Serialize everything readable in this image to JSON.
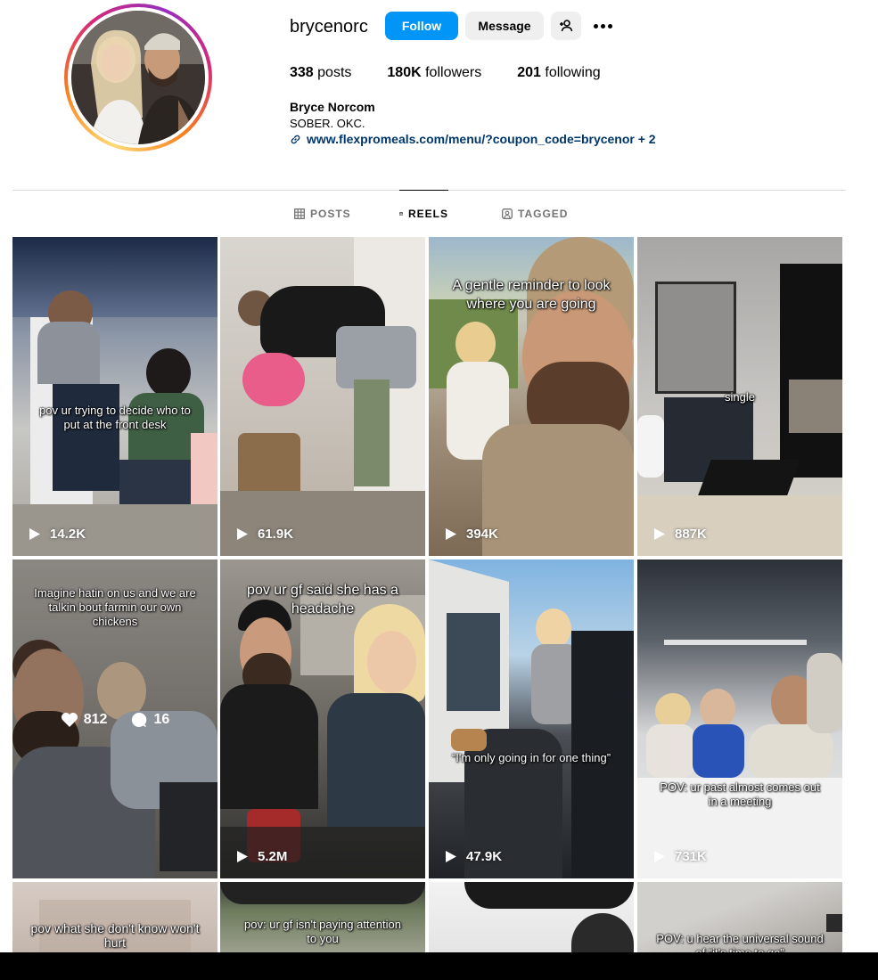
{
  "profile": {
    "username": "brycenorc",
    "follow_label": "Follow",
    "message_label": "Message",
    "posts_count": "338",
    "posts_label": "posts",
    "followers_count": "180K",
    "followers_label": "followers",
    "following_count": "201",
    "following_label": "following",
    "full_name": "Bryce Norcom",
    "bio": "SOBER. OKC.",
    "link": "www.flexpromeals.com/menu/?coupon_code=brycenor + 2"
  },
  "tabs": [
    {
      "label": "POSTS",
      "icon": "grid-icon",
      "active": false
    },
    {
      "label": "REELS",
      "icon": "reels-icon",
      "active": true
    },
    {
      "label": "TAGGED",
      "icon": "tagged-icon",
      "active": false
    }
  ],
  "reels": [
    {
      "caption": "pov ur trying to decide who to put at the front desk",
      "views": "14.2K"
    },
    {
      "caption": "",
      "views": "61.9K"
    },
    {
      "caption": "A gentle reminder to look where you are going",
      "views": "394K"
    },
    {
      "caption": "single",
      "views": "887K"
    },
    {
      "caption": "Imagine hatin on us and we are talkin bout farmin our own chickens",
      "likes": "812",
      "comments": "16"
    },
    {
      "caption": "pov ur gf said she has a headache",
      "views": "5.2M"
    },
    {
      "caption": "“I'm only going in for one thing”",
      "views": "47.9K"
    },
    {
      "caption": "POV: ur past almost comes out in a meeting",
      "views": "731K"
    },
    {
      "caption": "pov what she don't know won't hurt"
    },
    {
      "caption": "pov: ur gf isn't paying attention to you"
    },
    {
      "caption": ""
    },
    {
      "caption": "POV: u hear the universal sound of “it's time to go”"
    }
  ],
  "colors": {
    "accent": "#0095f6",
    "link": "#00376b",
    "muted": "#737373"
  }
}
